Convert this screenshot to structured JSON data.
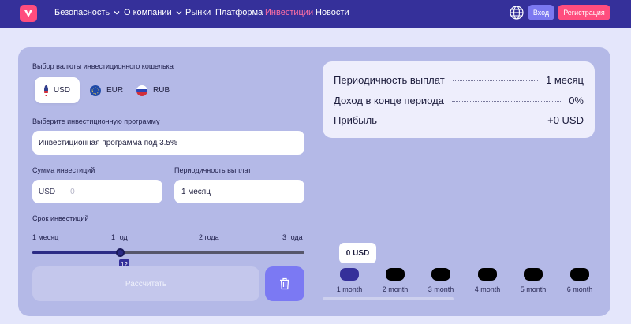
{
  "nav": {
    "items": [
      {
        "label": "Безопасность",
        "dropdown": true
      },
      {
        "label": "О компании",
        "dropdown": true
      },
      {
        "label": "Рынки",
        "dropdown": false
      },
      {
        "label": "Платформа",
        "dropdown": false
      },
      {
        "label": "Инвестиции",
        "dropdown": false,
        "active": true
      },
      {
        "label": "Новости",
        "dropdown": false
      }
    ],
    "login_label": "Вход",
    "register_label": "Регистрация"
  },
  "form": {
    "currency_label": "Выбор валюты инвестиционного кошелька",
    "currencies": [
      {
        "code": "USD",
        "selected": true
      },
      {
        "code": "EUR",
        "selected": false
      },
      {
        "code": "RUB",
        "selected": false
      }
    ],
    "program_label": "Выберите инвестиционную программу",
    "program_value": "Инвестиционная программа под 3.5%",
    "amount_label": "Сумма инвестиций",
    "amount_currency": "USD",
    "amount_placeholder": "0",
    "period_label": "Периодичность выплат",
    "period_value": "1 месяц",
    "term_label": "Срок инвестиций",
    "term_ticks": [
      "1 месяц",
      "1 год",
      "2 года",
      "3 года"
    ],
    "term_value": "12",
    "term_fraction": 0.32,
    "calculate_label": "Рассчитать"
  },
  "results": {
    "rows": [
      {
        "label": "Периодичность выплат",
        "value": "1 месяц"
      },
      {
        "label": "Доход в конце периода",
        "value": "0%"
      },
      {
        "label": "Прибыль",
        "value": "+0 USD"
      }
    ]
  },
  "chart": {
    "tooltip": "0 USD",
    "months": [
      "1 month",
      "2 month",
      "3 month",
      "4 month",
      "5 month",
      "6 month"
    ],
    "active_index": 0
  },
  "colors": {
    "header_bg": "#35309a",
    "accent_pink": "#ff4d7e",
    "accent_purple": "#7b78f0",
    "card_bg": "#b4b9e7"
  }
}
